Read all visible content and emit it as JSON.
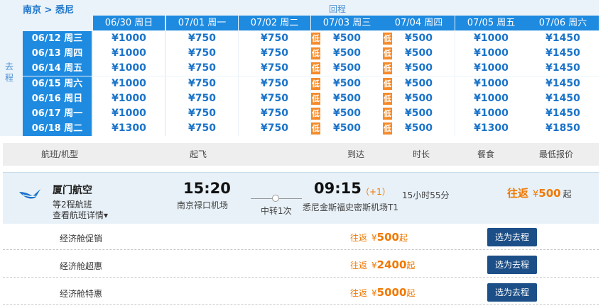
{
  "calendar": {
    "route": "南京 > 悉尼",
    "return_label": "回程",
    "depart_label": "去程",
    "low_label": "低",
    "return_dates": [
      "06/30 周日",
      "07/01 周一",
      "07/02 周二",
      "07/03 周三",
      "07/04 周四",
      "07/05 周五",
      "07/06 周六"
    ],
    "depart_rows": [
      {
        "date": "06/12 周三",
        "prices": [
          "¥1000",
          "¥750",
          "¥750",
          "¥500",
          "¥500",
          "¥1000",
          "¥1450"
        ]
      },
      {
        "date": "06/13 周四",
        "prices": [
          "¥1000",
          "¥750",
          "¥750",
          "¥500",
          "¥500",
          "¥1000",
          "¥1450"
        ]
      },
      {
        "date": "06/14 周五",
        "prices": [
          "¥1000",
          "¥750",
          "¥750",
          "¥500",
          "¥500",
          "¥1000",
          "¥1450"
        ]
      },
      {
        "date": "06/15 周六",
        "prices": [
          "¥1000",
          "¥750",
          "¥750",
          "¥500",
          "¥500",
          "¥1000",
          "¥1450"
        ]
      },
      {
        "date": "06/16 周日",
        "prices": [
          "¥1000",
          "¥750",
          "¥750",
          "¥500",
          "¥500",
          "¥1000",
          "¥1450"
        ]
      },
      {
        "date": "06/17 周一",
        "prices": [
          "¥1000",
          "¥750",
          "¥750",
          "¥500",
          "¥500",
          "¥1000",
          "¥1450"
        ]
      },
      {
        "date": "06/18 周二",
        "prices": [
          "¥1300",
          "¥750",
          "¥750",
          "¥500",
          "¥500",
          "¥1300",
          "¥1850"
        ]
      }
    ],
    "low_columns": [
      3,
      4
    ]
  },
  "table_header": {
    "flight": "航班/机型",
    "depart": "起飞",
    "arrive": "到达",
    "duration": "时长",
    "meal": "餐食",
    "lowest": "最低报价"
  },
  "flight": {
    "airline": "厦门航空",
    "flight_no": "等2程航班",
    "detail_link": "查看航班详情▾",
    "dep_time": "15:20",
    "dep_airport": "南京禄口机场",
    "transfer": "中转1次",
    "arr_time": "09:15",
    "arr_plus": "（+1）",
    "arr_airport": "悉尼金斯福史密斯机场T1",
    "duration": "15小时55分",
    "best_kind": "往返",
    "best_currency": "¥",
    "best_value": "500",
    "best_suffix": "起",
    "logo_icon": "airline-logo-icon",
    "brand_color": "#1a73c9"
  },
  "cabins": [
    {
      "name": "经济舱促销",
      "kind": "往返",
      "currency": "¥",
      "value": "500",
      "suffix": "起",
      "button": "选为去程"
    },
    {
      "name": "经济舱超惠",
      "kind": "往返",
      "currency": "¥",
      "value": "2400",
      "suffix": "起",
      "button": "选为去程"
    },
    {
      "name": "经济舱特惠",
      "kind": "往返",
      "currency": "¥",
      "value": "5000",
      "suffix": "起",
      "button": "选为去程"
    }
  ]
}
